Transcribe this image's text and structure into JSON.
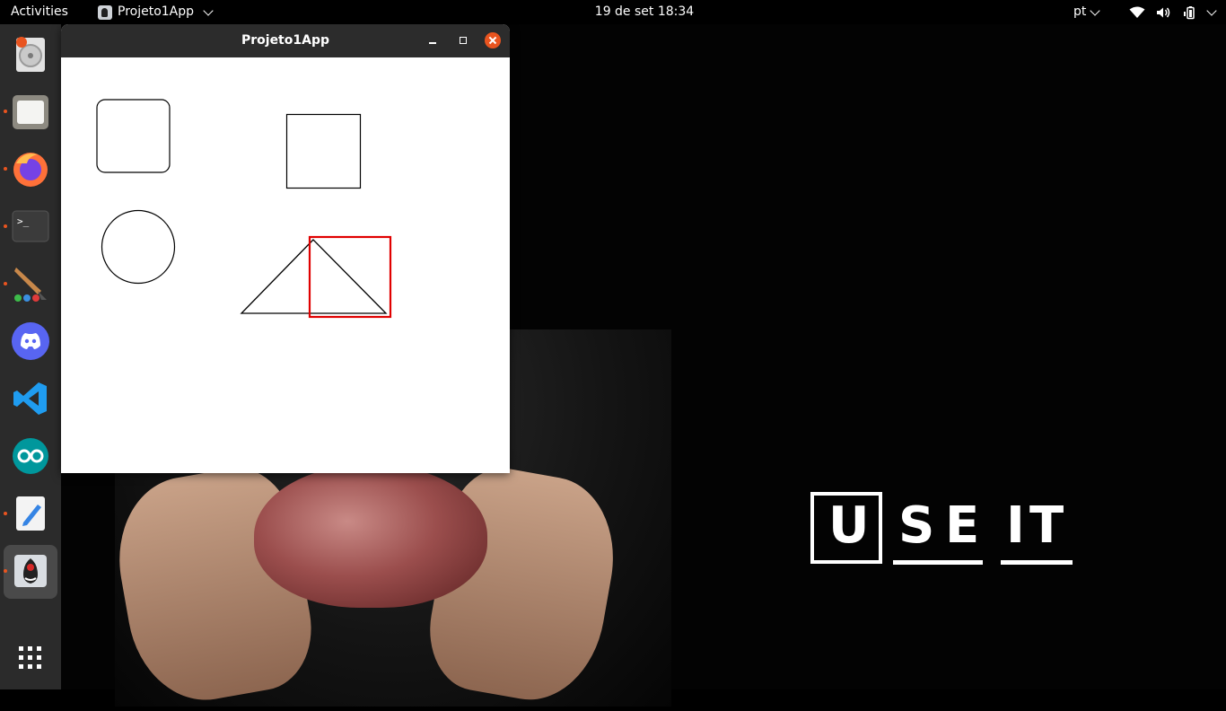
{
  "topbar": {
    "activities": "Activities",
    "app_name": "Projeto1App",
    "clock": "19 de set  18:34",
    "language": "pt",
    "tray_icons": [
      "wifi-icon",
      "volume-icon",
      "battery-icon",
      "system-menu-chevron-icon"
    ]
  },
  "dock": {
    "apps": [
      "ubuntu-software",
      "files",
      "firefox",
      "terminal",
      "paint",
      "discord",
      "vscode",
      "arduino",
      "text-editor",
      "java-app"
    ],
    "running": [
      "files",
      "firefox",
      "terminal",
      "paint",
      "text-editor",
      "java-app"
    ],
    "active": "java-app",
    "show_apps_icon": "grid-icon"
  },
  "window": {
    "title": "Projeto1App",
    "shapes": [
      "rounded-rectangle",
      "square",
      "circle",
      "triangle",
      "selection-rectangle"
    ],
    "colors": {
      "stroke": "#000000",
      "selection": "#e00000",
      "background": "#ffffff"
    }
  },
  "wallpaper": {
    "logo_letters": [
      "U",
      "S",
      "E",
      "I",
      "T"
    ]
  },
  "colors": {
    "accent": "#e9541f",
    "dock_bg": "#2b2b2b",
    "titlebar": "#2c2c2c"
  }
}
